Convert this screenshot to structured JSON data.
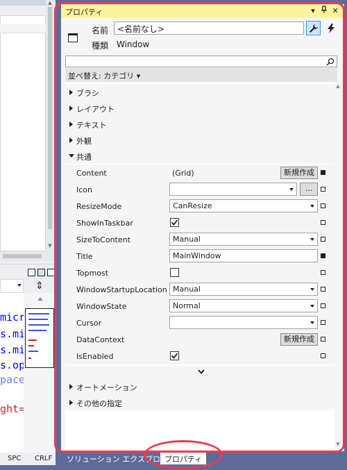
{
  "left_panel": {
    "code_lines": [
      {
        "text": "micro",
        "color": "#0000ff"
      },
      {
        "text": "s.mic",
        "color": "#0000ff"
      },
      {
        "text": "s.mic",
        "color": "#0000ff"
      },
      {
        "text": "s.op",
        "color": "#0000ff"
      },
      {
        "text": "pace",
        "color": "#6a7bd6"
      },
      {
        "text": "",
        "color": "#000000"
      },
      {
        "text": "ght='",
        "color": "#cc2222"
      }
    ],
    "status": {
      "encoding": "SPC",
      "line_ending": "CRLF"
    }
  },
  "properties": {
    "title": "プロパティ",
    "name_label": "名前",
    "name_value": "<名前なし>",
    "type_label": "種類",
    "type_value": "Window",
    "sort_label": "並べ替え: カテゴリ ▾",
    "categories_collapsed_top": [
      "ブラシ",
      "レイアウト",
      "テキスト",
      "外観"
    ],
    "common_category": "共通",
    "rows": {
      "content": {
        "name": "Content",
        "value": "(Grid)",
        "button": "新規作成"
      },
      "icon": {
        "name": "Icon",
        "value": "",
        "button": "..."
      },
      "resize_mode": {
        "name": "ResizeMode",
        "value": "CanResize"
      },
      "show_in_taskbar": {
        "name": "ShowInTaskbar",
        "checked": true
      },
      "size_to_content": {
        "name": "SizeToContent",
        "value": "Manual"
      },
      "title": {
        "name": "Title",
        "value": "MainWindow"
      },
      "topmost": {
        "name": "Topmost",
        "checked": false
      },
      "startup_location": {
        "name": "WindowStartupLocation",
        "value": "Manual"
      },
      "window_state": {
        "name": "WindowState",
        "value": "Normal"
      },
      "cursor": {
        "name": "Cursor",
        "value": ""
      },
      "data_context": {
        "name": "DataContext",
        "button": "新規作成"
      },
      "is_enabled": {
        "name": "IsEnabled",
        "checked": true
      }
    },
    "categories_collapsed_bottom": [
      "オートメーション",
      "その他の指定"
    ]
  },
  "bottom_tabs": [
    {
      "label": "ソリューション エクスプローラー",
      "active": false
    },
    {
      "label": "プロパティ",
      "active": true
    }
  ],
  "colors": {
    "title_bar": "#fff29d",
    "annotation": "#e83d4f",
    "frame": "#5d6b99"
  }
}
